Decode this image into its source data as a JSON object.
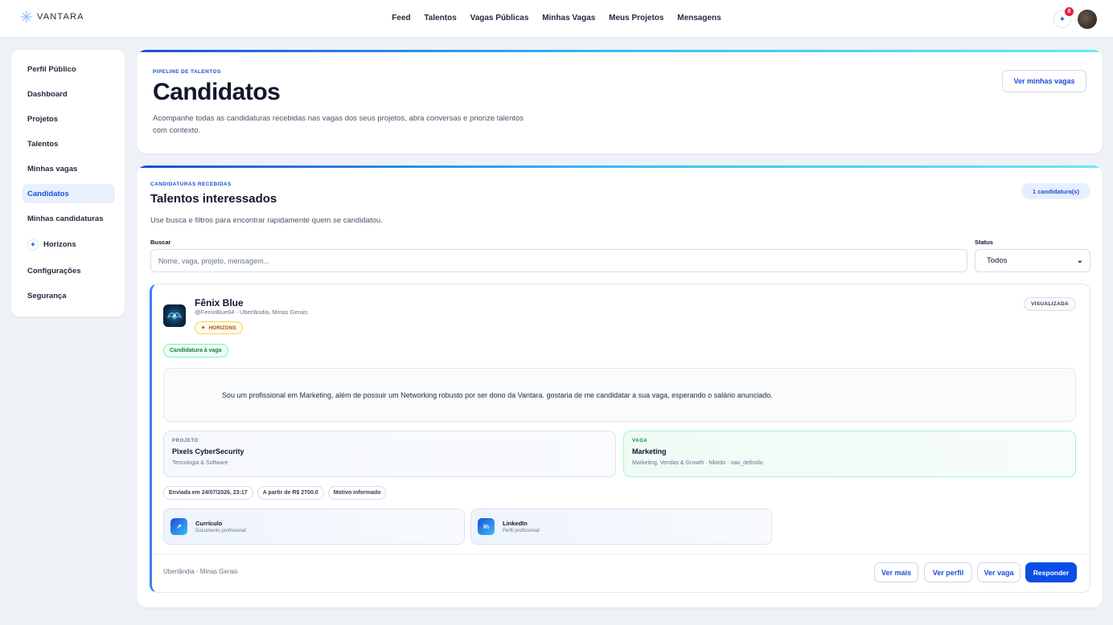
{
  "brand": {
    "name": "VANTARA"
  },
  "nav": [
    "Feed",
    "Talentos",
    "Vagas Públicas",
    "Minhas Vagas",
    "Meus Projetos",
    "Mensagens"
  ],
  "notifications": {
    "count": "8"
  },
  "sidebar": {
    "items": [
      {
        "label": "Perfil Público"
      },
      {
        "label": "Dashboard"
      },
      {
        "label": "Projetos"
      },
      {
        "label": "Talentos"
      },
      {
        "label": "Minhas vagas"
      },
      {
        "label": "Candidatos",
        "active": true
      },
      {
        "label": "Minhas candidaturas"
      },
      {
        "label": "Horizons"
      },
      {
        "label": "Configurações"
      },
      {
        "label": "Segurança"
      }
    ]
  },
  "hero": {
    "eyebrow": "PIPELINE DE TALENTOS",
    "title": "Candidatos",
    "description": "Acompanhe todas as candidaturas recebidas nas vagas dos seus projetos, abra conversas e priorize talentos com contexto.",
    "button": "Ver minhas vagas"
  },
  "main": {
    "eyebrow": "CANDIDATURAS RECEBIDAS",
    "title": "Talentos interessados",
    "description": "Use busca e filtros para encontrar rapidamente quem se candidatou.",
    "count": "1 candidatura(s)",
    "search": {
      "label": "Buscar",
      "placeholder": "Nome, vaga, projeto, mensagem...",
      "value": ""
    },
    "status": {
      "label": "Status",
      "value": "Todos"
    }
  },
  "candidate": {
    "name": "Fênix Blue",
    "handle": "@FenixBlue64 · Uberlândia, Minas Gerais",
    "horizons": "HORIZONS",
    "status": "VISUALIZADA",
    "type": "Candidatura à vaga",
    "message": "Sou um profissional em Marketing, além de possuir um Networking robusto por ser dono da Vantara. gostaria de me candidatar a sua vaga, esperando o salário anunciado.",
    "project": {
      "eyebrow": "PROJETO",
      "title": "Pixels CyberSecurity",
      "sub": "Tecnologia & Software"
    },
    "job": {
      "eyebrow": "VAGA",
      "title": "Marketing",
      "sub": "Marketing, Vendas & Growth · hibrido · nao_definido"
    },
    "meta": [
      "Enviada em 24/07/2026, 23:17",
      "A partir de R$ 2700.0",
      "Motivo informado"
    ],
    "docs": [
      {
        "title": "Currículo",
        "sub": "Documento profissional",
        "icon": "document-icon"
      },
      {
        "title": "LinkedIn",
        "sub": "Perfil profissional",
        "icon": "linkedin-icon"
      }
    ],
    "location": "Uberlândia · Minas Gerais",
    "actions": {
      "more": "Ver mais",
      "profile": "Ver perfil",
      "job": "Ver vaga",
      "reply": "Responder"
    }
  },
  "colors": {
    "accent": "#1d4ed8",
    "primary_button": "#0b4ee6",
    "badge": "#e11d48"
  }
}
